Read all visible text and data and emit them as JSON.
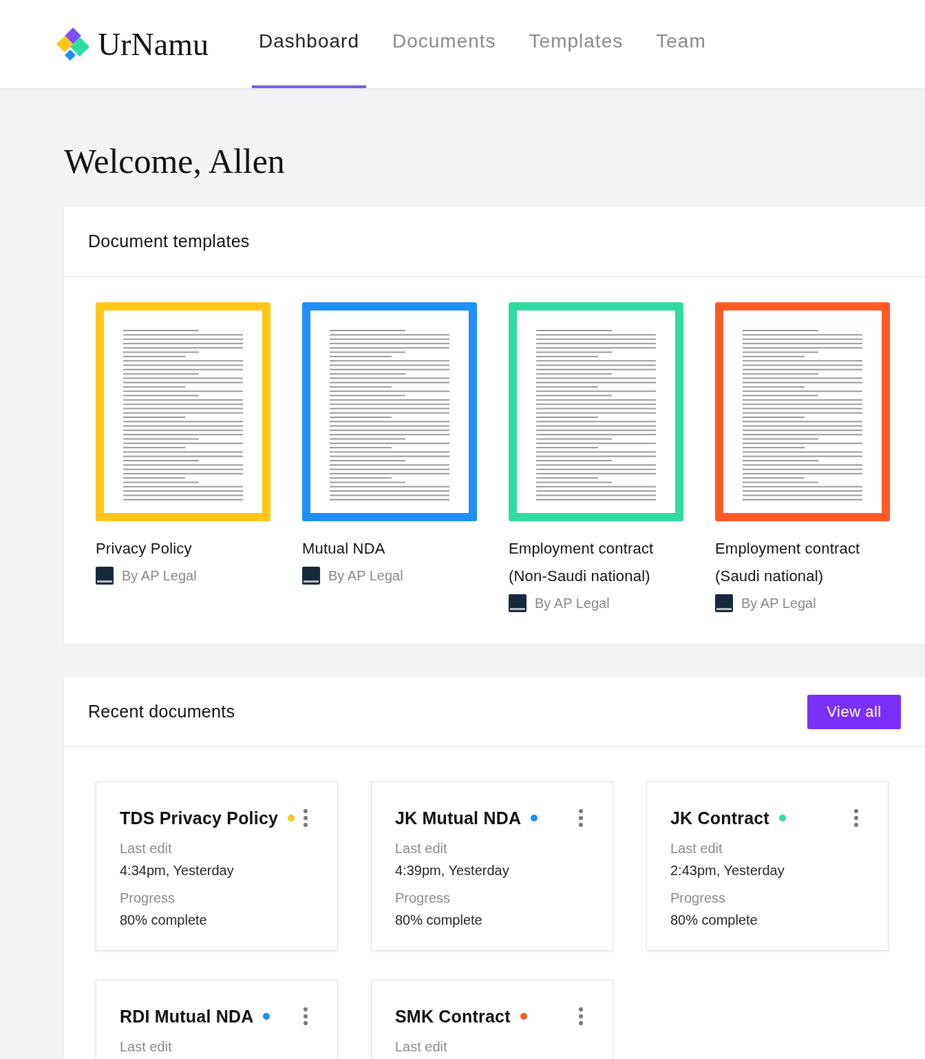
{
  "header": {
    "brand": "UrNamu",
    "tabs": [
      {
        "label": "Dashboard",
        "selected": true
      },
      {
        "label": "Documents",
        "selected": false
      },
      {
        "label": "Templates",
        "selected": false
      },
      {
        "label": "Team",
        "selected": false
      }
    ]
  },
  "welcome": "Welcome, Allen",
  "templates": {
    "title": "Document templates",
    "items": [
      {
        "name": "Privacy Policy",
        "author": "By AP Legal",
        "color": "#ffc61a"
      },
      {
        "name": "Mutual NDA",
        "author": "By AP Legal",
        "color": "#1e8ff5"
      },
      {
        "name": "Employment contract (Non-Saudi national)",
        "author": "By AP Legal",
        "color": "#2fdca0"
      },
      {
        "name": "Employment contract (Saudi national)",
        "author": "By AP Legal",
        "color": "#ff5a26"
      }
    ]
  },
  "recent": {
    "title": "Recent documents",
    "view_all": "View all",
    "items": [
      {
        "name": "TDS Privacy Policy",
        "color": "#ffc61a",
        "edit_label": "Last edit",
        "edit_time": "4:34pm, Yesterday",
        "progress_label": "Progress",
        "progress": "80% complete"
      },
      {
        "name": "JK Mutual NDA",
        "color": "#1e8ff5",
        "edit_label": "Last edit",
        "edit_time": "4:39pm, Yesterday",
        "progress_label": "Progress",
        "progress": "80% complete"
      },
      {
        "name": "JK Contract",
        "color": "#2fdca0",
        "edit_label": "Last edit",
        "edit_time": "2:43pm, Yesterday",
        "progress_label": "Progress",
        "progress": "80% complete"
      },
      {
        "name": "RDI Mutual NDA",
        "color": "#1e8ff5",
        "edit_label": "Last edit"
      },
      {
        "name": "SMK Contract",
        "color": "#ff5a26",
        "edit_label": "Last edit"
      }
    ]
  }
}
